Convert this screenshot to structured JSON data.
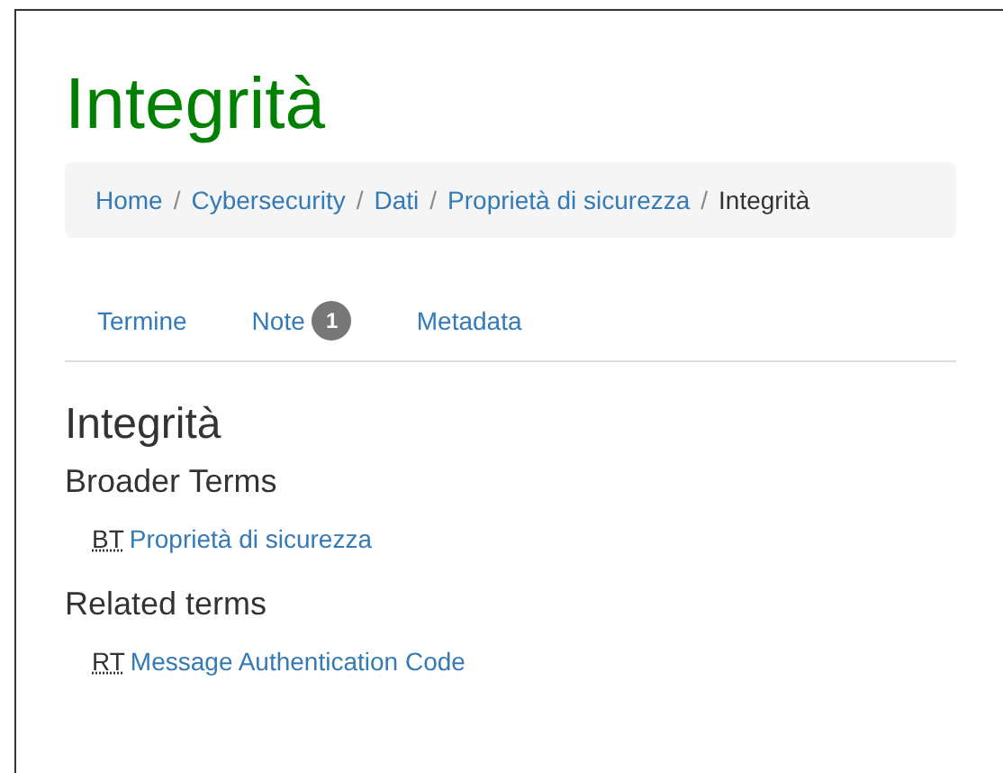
{
  "title": "Integrità",
  "breadcrumb": [
    {
      "label": "Home",
      "current": false,
      "separator": "/"
    },
    {
      "label": "Cybersecurity",
      "current": false,
      "separator": "/"
    },
    {
      "label": "Dati",
      "current": false,
      "separator": "/"
    },
    {
      "label": "Proprietà di sicurezza",
      "current": false,
      "separator": "/"
    },
    {
      "label": "Integrità",
      "current": true
    }
  ],
  "tabs": [
    {
      "label": "Termine"
    },
    {
      "label": "Note",
      "badge": "1"
    },
    {
      "label": "Metadata"
    }
  ],
  "term": "Integrità",
  "sections": [
    {
      "heading": "Broader Terms",
      "items": [
        {
          "abbr": "BT",
          "link": "Proprietà di sicurezza"
        }
      ]
    },
    {
      "heading": "Related terms",
      "items": [
        {
          "abbr": "RT",
          "link": "Message Authentication Code"
        }
      ]
    }
  ]
}
